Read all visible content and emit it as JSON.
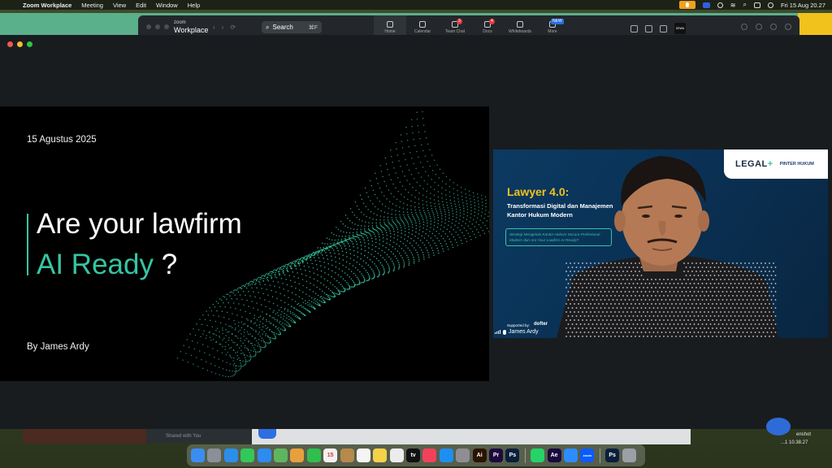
{
  "menubar": {
    "app_name": "Zoom Workplace",
    "menus": [
      "Meeting",
      "View",
      "Edit",
      "Window",
      "Help"
    ],
    "datetime": "Fri 15 Aug  20.27"
  },
  "zoom_window": {
    "brand_top": "zoom",
    "brand_bottom": "Workplace",
    "search_label": "Search",
    "search_shortcut": "⌘F",
    "tabs": [
      {
        "label": "Home",
        "badge": ""
      },
      {
        "label": "Calendar",
        "badge": ""
      },
      {
        "label": "Team Chat",
        "badge": "3"
      },
      {
        "label": "Docs",
        "badge": "4"
      },
      {
        "label": "Whiteboards",
        "badge": ""
      },
      {
        "label": "More",
        "badge": "NEW"
      }
    ],
    "avatar_text": "DEWA"
  },
  "slide": {
    "date": "15 Agustus 2025",
    "headline_line1": "Are your lawfirm",
    "headline_accent": "AI Ready",
    "headline_suffix": " ?",
    "byline": "By James Ardy",
    "accent_color": "#35c5a2"
  },
  "participant": {
    "logo_text": "LEGAL",
    "logo_plus": "+",
    "logo_partner": "PINTER HUKUM",
    "title": "Lawyer 4.0:",
    "subtitle_line1": "Transformasi Digital dan Manajemen",
    "subtitle_line2": "Kantor Hukum Modern",
    "box_line1": "Strategi Mengelola Kantor Hukum Secara Profesional",
    "box_line2": "Modern dan Are Your Lawfirm AI-Ready?",
    "supported_by": "Supported by:",
    "sponsor": "dofter",
    "name": "James Ardy"
  },
  "desktop": {
    "shared_with_you": "Shared with You",
    "screenshot_line1": "enshot",
    "screenshot_line2": "...1 10.38.27"
  },
  "dock": {
    "apps": [
      {
        "name": "finder",
        "color": "#3a8ef0",
        "label": ""
      },
      {
        "name": "launchpad",
        "color": "#8a8f99",
        "label": ""
      },
      {
        "name": "safari",
        "color": "#2b8ee8",
        "label": ""
      },
      {
        "name": "messages",
        "color": "#34c759",
        "label": ""
      },
      {
        "name": "mail",
        "color": "#2d8cf0",
        "label": ""
      },
      {
        "name": "maps",
        "color": "#5fb55f",
        "label": ""
      },
      {
        "name": "photos",
        "color": "#e8a03c",
        "label": ""
      },
      {
        "name": "facetime",
        "color": "#2fbf4d",
        "label": ""
      },
      {
        "name": "calendar",
        "color": "#f2f2f2",
        "label": "15"
      },
      {
        "name": "notes-brown",
        "color": "#b58a4a",
        "label": ""
      },
      {
        "name": "reminders",
        "color": "#f5f5f5",
        "label": ""
      },
      {
        "name": "notes",
        "color": "#f6d24a",
        "label": ""
      },
      {
        "name": "freeform",
        "color": "#ececec",
        "label": ""
      },
      {
        "name": "tv",
        "color": "#111111",
        "label": "tv"
      },
      {
        "name": "music",
        "color": "#f2425b",
        "label": ""
      },
      {
        "name": "app-store",
        "color": "#1f8ef1",
        "label": ""
      },
      {
        "name": "system-settings",
        "color": "#8e8e93",
        "label": ""
      },
      {
        "name": "illustrator",
        "color": "#2a1400",
        "label": "Ai"
      },
      {
        "name": "premiere",
        "color": "#1d0a3c",
        "label": "Pr"
      },
      {
        "name": "photoshop",
        "color": "#0a1f3c",
        "label": "Ps"
      },
      {
        "name": "whatsapp",
        "color": "#25d366",
        "label": ""
      },
      {
        "name": "after-effects",
        "color": "#1a0a3c",
        "label": "Ae"
      },
      {
        "name": "zoom-app",
        "color": "#2d8cff",
        "label": ""
      },
      {
        "name": "zoom-workplace",
        "color": "#0b5cff",
        "label": "zoom"
      },
      {
        "name": "photoshop-file",
        "color": "#0a1f3c",
        "label": "Ps"
      },
      {
        "name": "trash",
        "color": "#9ba0a6",
        "label": ""
      }
    ]
  }
}
